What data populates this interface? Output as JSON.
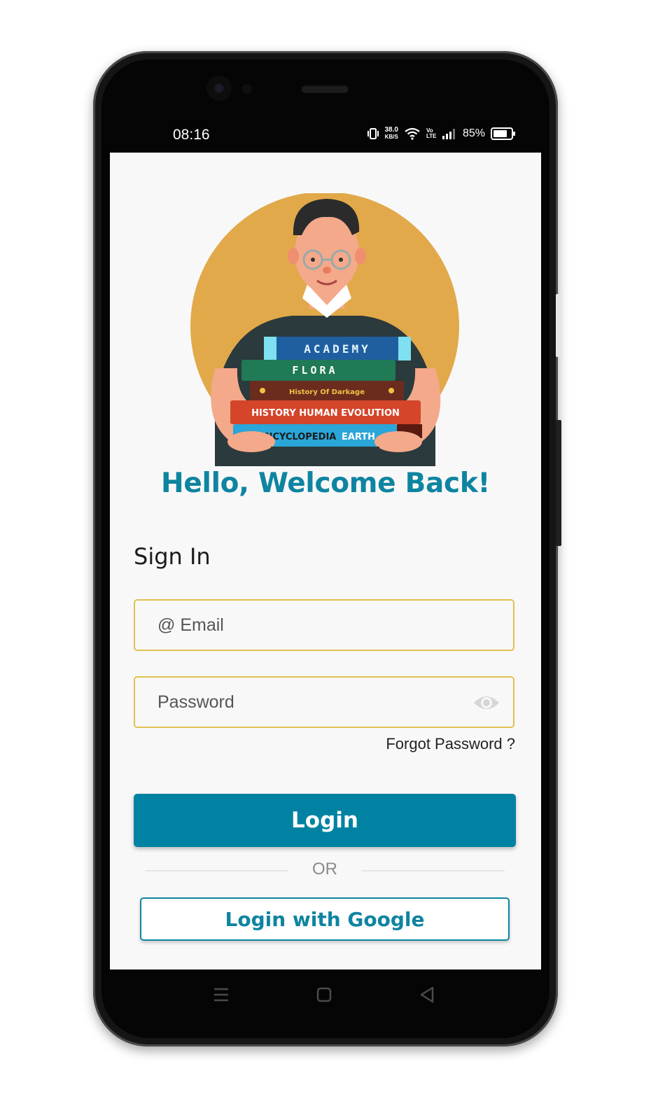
{
  "status_bar": {
    "time": "08:16",
    "net_speed_value": "38.0",
    "net_speed_unit": "KB/S",
    "volte": "Vo LTE",
    "battery_percent": "85%",
    "battery_level": 0.85
  },
  "hero": {
    "illustration": "man-holding-books",
    "books": [
      "ACADEMY",
      "FLORA",
      "History Of Darkage",
      "HISTORY HUMAN EVOLUTION",
      "ENCYCLOPEDIA",
      "EARTH"
    ]
  },
  "welcome_title": "Hello, Welcome Back!",
  "sign_in_heading": "Sign In",
  "email_field": {
    "placeholder": "@ Email",
    "value": ""
  },
  "password_field": {
    "placeholder": "Password",
    "value": "",
    "icon": "eye-icon"
  },
  "forgot_password": "Forgot Password ?",
  "login_button": "Login",
  "divider_text": "OR",
  "google_button": "Login with Google",
  "colors": {
    "primary": "#0282a3",
    "title": "#0e84a1",
    "input_border": "#e2c04f",
    "background": "#f8f8f8",
    "hero_circle": "#e2a94a"
  },
  "nav_bar": {
    "icons": [
      "menu-icon",
      "home-icon",
      "back-icon"
    ]
  }
}
